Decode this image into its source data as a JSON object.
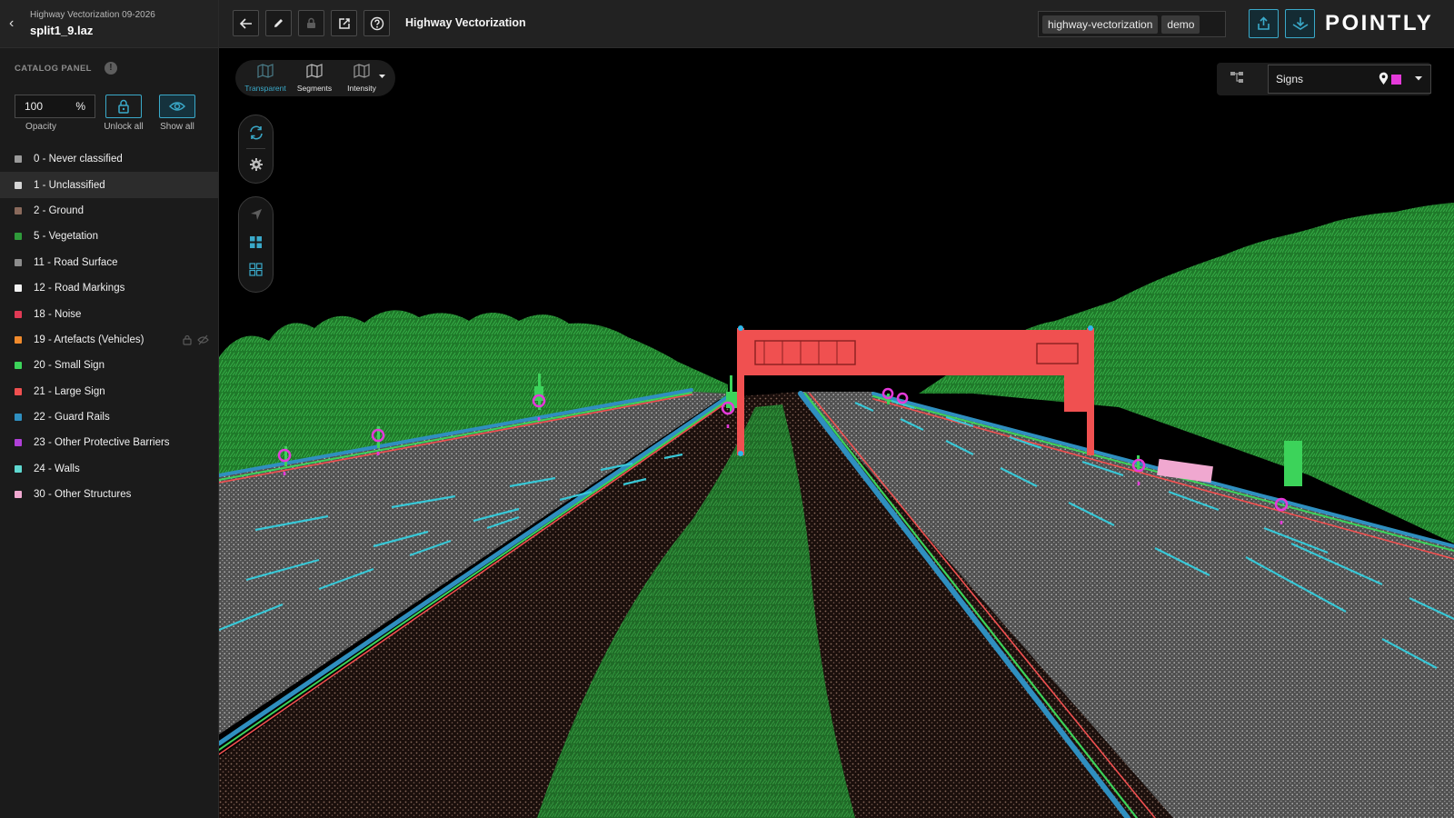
{
  "project": {
    "title": "Highway Vectorization 09-2026",
    "file": "split1_9.laz"
  },
  "catalog": {
    "label": "CATALOG PANEL",
    "opacity_value": "100",
    "opacity_unit": "%",
    "opacity_label": "Opacity",
    "unlock_label": "Unlock all",
    "show_label": "Show all"
  },
  "classes": [
    {
      "label": "0 - Never classified",
      "color": "#9a9a9a"
    },
    {
      "label": "1 - Unclassified",
      "color": "#d6d6d6"
    },
    {
      "label": "2 - Ground",
      "color": "#8a6a5c"
    },
    {
      "label": "5 - Vegetation",
      "color": "#2f9a3a"
    },
    {
      "label": "11 - Road Surface",
      "color": "#8d8d8d"
    },
    {
      "label": "12 - Road Markings",
      "color": "#f2f2f2"
    },
    {
      "label": "18 - Noise",
      "color": "#e03a55"
    },
    {
      "label": "19 - Artefacts (Vehicles)",
      "color": "#f08a2c"
    },
    {
      "label": "20 - Small Sign",
      "color": "#3cd35a"
    },
    {
      "label": "21 - Large Sign",
      "color": "#f05050"
    },
    {
      "label": "22 - Guard Rails",
      "color": "#2f8fc0"
    },
    {
      "label": "23 - Other Protective Barriers",
      "color": "#b040d8"
    },
    {
      "label": "24 - Walls",
      "color": "#5fd8d0"
    },
    {
      "label": "30 - Other Structures",
      "color": "#f0a8d0"
    }
  ],
  "topbar": {
    "title": "Highway Vectorization",
    "tags": [
      "highway-vectorization",
      "demo"
    ],
    "logo": "POINTLY"
  },
  "view_modes": [
    {
      "label": "Transparent",
      "active": true
    },
    {
      "label": "Segments",
      "active": false
    },
    {
      "label": "Intensity",
      "active": false
    }
  ],
  "layer": {
    "selected": "Signs",
    "swatch_color": "#e43ad9"
  },
  "help_mark": "?",
  "icons": {
    "back": "chevron-left-icon",
    "info": "info-icon",
    "lock": "lock-icon",
    "eye": "eye-icon",
    "arrow": "arrow-left-icon",
    "pencil": "pencil-icon",
    "share": "share-icon",
    "help": "help-icon",
    "upload": "upload-icon",
    "download": "download-icon"
  },
  "colors": {
    "accent": "#3aa9c9",
    "vegetation": "#2f9a3a",
    "large_sign": "#f05050",
    "guard_rail": "#2f8fc0",
    "road_marking": "#38c7d6",
    "marker": "#e43ad9"
  }
}
